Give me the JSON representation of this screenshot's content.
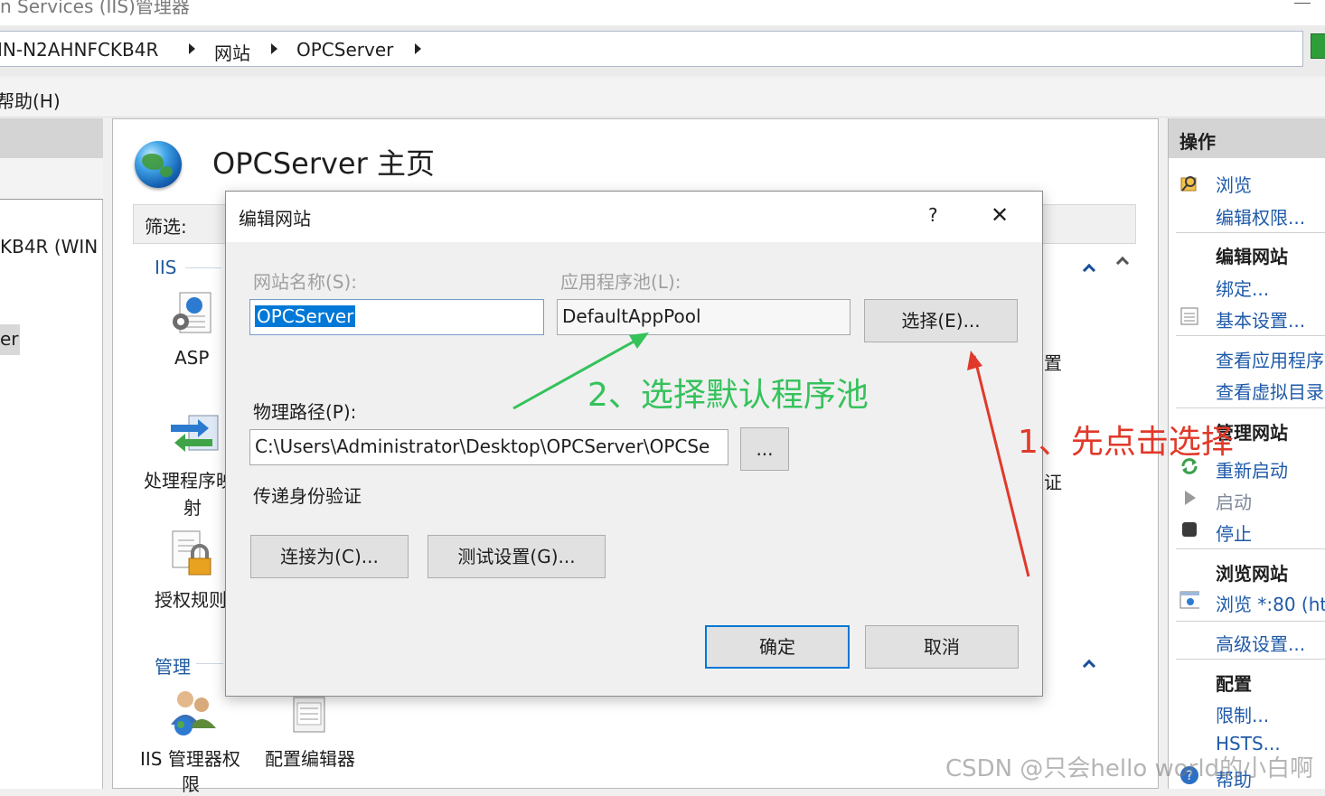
{
  "window": {
    "title": "n Services (IIS)管理器"
  },
  "address": {
    "breadcrumbs": [
      "IN-N2AHNFCKB4R",
      "网站",
      "OPCServer"
    ]
  },
  "menu": {
    "help": "帮助(H)"
  },
  "tree": {
    "server": "KB4R (WIN",
    "site": "er"
  },
  "main": {
    "title": "OPCServer 主页",
    "filter_label": "筛选:",
    "group_iis": "IIS",
    "group_mgmt": "管理",
    "features": {
      "asp": "ASP",
      "handler_line1": "处理程序映",
      "handler_line2": "射",
      "auth_rules": "授权规则",
      "iis_perm_line1": "IIS 管理器权",
      "iis_perm_line2": "限",
      "config_editor": "配置编辑器",
      "partial_right1": "置",
      "partial_right2": "证"
    }
  },
  "actions": {
    "title": "操作",
    "browse": "浏览",
    "edit_perms": "编辑权限...",
    "edit_site_header": "编辑网站",
    "bindings": "绑定...",
    "basic_settings": "基本设置...",
    "view_apps": "查看应用程序",
    "view_vdirs": "查看虚拟目录",
    "manage_site_header": "管理网站",
    "restart": "重新启动",
    "start": "启动",
    "stop": "停止",
    "browse_site_header": "浏览网站",
    "browse_80": "浏览 *:80 (ht",
    "advanced": "高级设置...",
    "config_header": "配置",
    "limits": "限制...",
    "hsts": "HSTS...",
    "help": "帮助"
  },
  "dialog": {
    "title": "编辑网站",
    "help_glyph": "?",
    "close_glyph": "✕",
    "site_name_label": "网站名称(S):",
    "site_name_value": "OPCServer",
    "app_pool_label": "应用程序池(L):",
    "app_pool_value": "DefaultAppPool",
    "select_button": "选择(E)...",
    "physical_path_label": "物理路径(P):",
    "physical_path_value": "C:\\Users\\Administrator\\Desktop\\OPCServer\\OPCSe",
    "browse_button": "...",
    "passthrough_label": "传递身份验证",
    "connect_as_button": "连接为(C)...",
    "test_settings_button": "测试设置(G)...",
    "ok_button": "确定",
    "cancel_button": "取消"
  },
  "annotations": {
    "step1": "1、先点击选择",
    "step2": "2、选择默认程序池",
    "step1_color": "#e0392a",
    "step2_color": "#35c25b"
  },
  "watermark": "CSDN @只会hello world的小白啊"
}
